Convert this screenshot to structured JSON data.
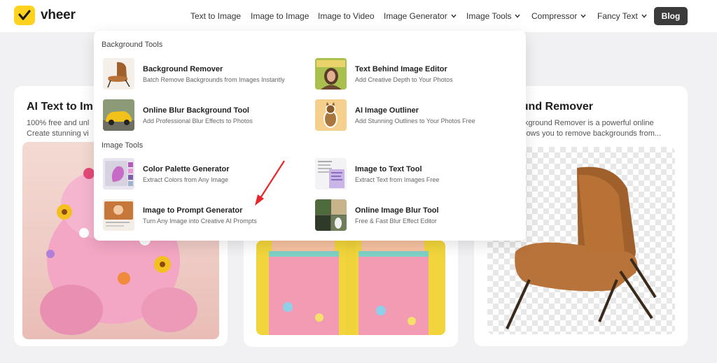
{
  "brand": {
    "name": "vheer",
    "accent": "#ffd21e"
  },
  "nav": {
    "items": [
      {
        "label": "Text to Image",
        "dropdown": false
      },
      {
        "label": "Image to Image",
        "dropdown": false
      },
      {
        "label": "Image to Video",
        "dropdown": false
      },
      {
        "label": "Image Generator",
        "dropdown": true
      },
      {
        "label": "Image Tools",
        "dropdown": true
      },
      {
        "label": "Compressor",
        "dropdown": true
      },
      {
        "label": "Fancy Text",
        "dropdown": true
      }
    ],
    "blog_label": "Blog"
  },
  "cards": {
    "left": {
      "title": "AI Text to Im",
      "desc_line1": "100% free and unl",
      "desc_line2": "Create stunning vi"
    },
    "right": {
      "title": "ound Remover",
      "desc_line1": "kground Remover is a powerful online",
      "desc_line2": "lows you to remove backgrounds from..."
    }
  },
  "dropdown": {
    "sections": [
      {
        "label": "Background Tools",
        "items": [
          {
            "title": "Background Remover",
            "desc": "Batch Remove Backgrounds from Images Instantly",
            "icon": "chair-thumbnail"
          },
          {
            "title": "Text Behind Image Editor",
            "desc": "Add Creative Depth to Your Photos",
            "icon": "portrait-thumbnail"
          },
          {
            "title": "Online Blur Background Tool",
            "desc": "Add Professional Blur Effects to Photos",
            "icon": "car-thumbnail"
          },
          {
            "title": "AI Image Outliner",
            "desc": "Add Stunning Outlines to Your Photos Free",
            "icon": "cat-thumbnail"
          }
        ]
      },
      {
        "label": "Image Tools",
        "items": [
          {
            "title": "Color Palette Generator",
            "desc": "Extract Colors from Any Image",
            "icon": "palette-thumbnail"
          },
          {
            "title": "Image to Text Tool",
            "desc": "Extract Text from Images Free",
            "icon": "document-thumbnail"
          },
          {
            "title": "Image to Prompt Generator",
            "desc": "Turn Any Image into Creative AI Prompts",
            "icon": "prompt-thumbnail"
          },
          {
            "title": "Online Image Blur Tool",
            "desc": "Free & Fast Blur Effect Editor",
            "icon": "blur-thumbnail"
          }
        ]
      }
    ]
  },
  "annotation": {
    "arrow_color": "#e8262a"
  }
}
